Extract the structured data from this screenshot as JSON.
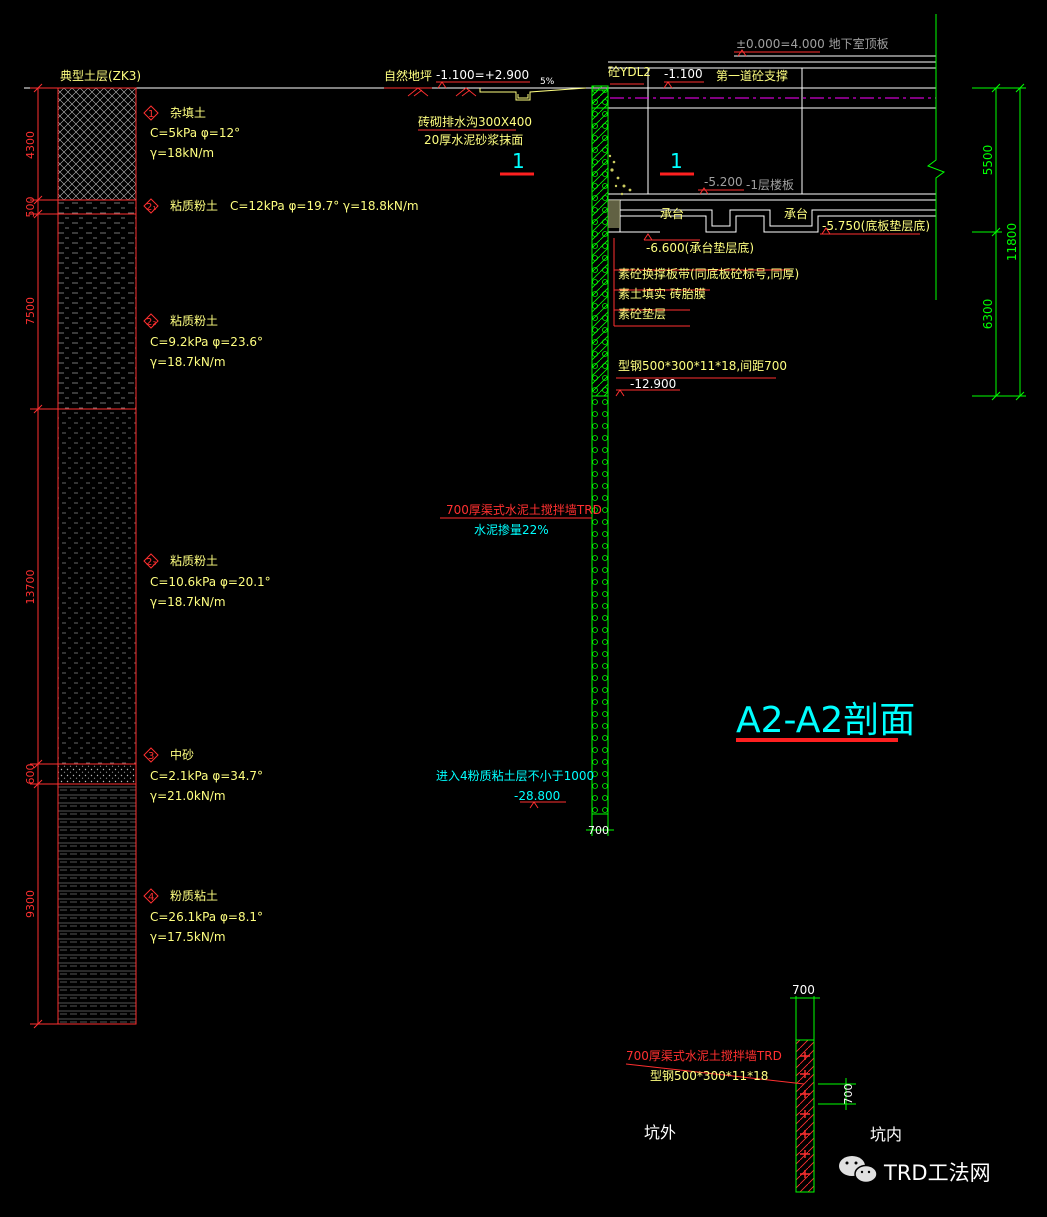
{
  "colors": {
    "background": "#000000",
    "soil_text": "#ffff80",
    "note_text": "#00ffff",
    "wall_green": "#00ff00",
    "red": "#ff2020",
    "white": "#ffffff",
    "magenta": "#ff00ff",
    "gray": "#a0a0a0"
  },
  "soil_profile": {
    "title": "典型土层(ZK3)",
    "layers": [
      {
        "no": "1",
        "name": "杂填土",
        "thickness": "4300",
        "params": [
          "C=5kPa  φ=12°",
          "γ=18kN/m"
        ]
      },
      {
        "no": "2₁",
        "name": "粘质粉土",
        "thickness": "500",
        "params": [
          "C=12kPa  φ=19.7° γ=18.8kN/m"
        ]
      },
      {
        "no": "2₂",
        "name": "粘质粉土",
        "thickness": "7500",
        "params": [
          "C=9.2kPa  φ=23.6°",
          "γ=18.7kN/m"
        ]
      },
      {
        "no": "2₃",
        "name": "粘质粉土",
        "thickness": "13700",
        "params": [
          "C=10.6kPa  φ=20.1°",
          "γ=18.7kN/m"
        ]
      },
      {
        "no": "3",
        "name": "中砂",
        "thickness": "600",
        "params": [
          "C=2.1kPa  φ=34.7°",
          "γ=21.0kN/m"
        ]
      },
      {
        "no": "4",
        "name": "粉质粘土",
        "thickness": "9300",
        "params": [
          "C=26.1kPa  φ=8.1°",
          "γ=17.5kN/m"
        ]
      }
    ]
  },
  "ground": {
    "label_natural": "自然地坪",
    "elev": "-1.100=+2.900",
    "slope": "5%",
    "ditch_note_1": "砖砌排水沟300X400",
    "ditch_note_2": "20厚水泥砂浆抹面",
    "section_mark": "1"
  },
  "structure": {
    "roof_label": "±0.000=4.000 地下室顶板",
    "beam_label": "砼YDL2",
    "strut_elev": "-1.100",
    "strut_label": "第一道砼支撑",
    "section_mark": "1",
    "floor_elev": "-5.200",
    "floor_label": "-1层楼板",
    "cap_left": "承台",
    "cap_right": "承台",
    "base_elev": "-5.750(底板垫层底)",
    "cap_elev": "-6.600(承台垫层底)",
    "notes": [
      "素砼换撑板带(同底板砼标号,同厚)",
      "素土填实  砖胎膜",
      "素砼垫层"
    ],
    "steel_note": "型钢500*300*11*18,间距700",
    "steel_bottom": "-12.900"
  },
  "right_dims": {
    "top": "5500",
    "bottom": "6300",
    "total": "11800"
  },
  "wall": {
    "note_1": "700厚渠式水泥土搅拌墙TRD",
    "note_2": "水泥掺量22%",
    "embed_note": "进入4粉质粘土层不小于1000",
    "bottom_elev": "-28.800",
    "width": "700"
  },
  "title": "A2-A2剖面",
  "detail": {
    "top_dim": "700",
    "note_1": "700厚渠式水泥土搅拌墙TRD",
    "note_2": "型钢500*300*11*18",
    "spacing": "700",
    "outside": "坑外",
    "inside": "坑内"
  },
  "watermark": "TRD工法网"
}
